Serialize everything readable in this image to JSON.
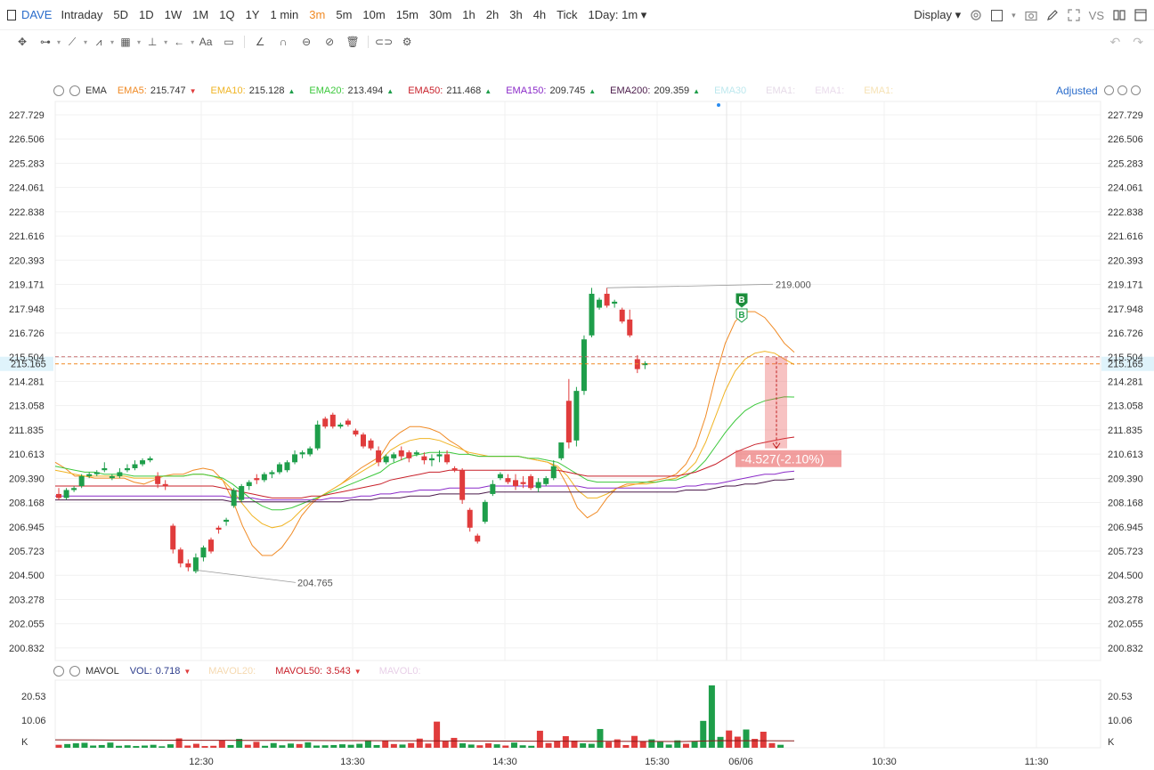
{
  "toolbar": {
    "symbol": "DAVE",
    "timeframes": [
      "Intraday",
      "5D",
      "1D",
      "1W",
      "1M",
      "1Q",
      "1Y",
      "1 min",
      "3m",
      "5m",
      "10m",
      "15m",
      "30m",
      "1h",
      "2h",
      "3h",
      "4h",
      "Tick"
    ],
    "active_timeframe": "3m",
    "range_select": "1Day: 1m",
    "display_label": "Display",
    "vs_label": "VS"
  },
  "ema_legend": {
    "name": "EMA",
    "items": [
      {
        "label": "EMA5:",
        "value": "215.747",
        "dir": "▼",
        "color": "#f08a24"
      },
      {
        "label": "EMA10:",
        "value": "215.128",
        "dir": "▲",
        "color": "#f0b424"
      },
      {
        "label": "EMA20:",
        "value": "213.494",
        "dir": "▲",
        "color": "#3cc83c"
      },
      {
        "label": "EMA50:",
        "value": "211.468",
        "dir": "▲",
        "color": "#c8202a"
      },
      {
        "label": "EMA150:",
        "value": "209.745",
        "dir": "▲",
        "color": "#8a2ac8"
      },
      {
        "label": "EMA200:",
        "value": "209.359",
        "dir": "▲",
        "color": "#4a1a4a"
      }
    ],
    "faded": [
      "EMA30",
      "EMA1:",
      "EMA1:",
      "EMA1:"
    ],
    "adjusted_label": "Adjusted"
  },
  "vol_legend": {
    "name": "MAVOL",
    "vol_label": "VOL:",
    "vol_value": "0.718",
    "mavol20_label": "MAVOL20:",
    "mavol50_label": "MAVOL50:",
    "mavol50_value": "3.543",
    "mavol0_label": "MAVOL0:"
  },
  "price_axis": [
    "227.729",
    "226.506",
    "225.283",
    "224.061",
    "222.838",
    "221.616",
    "220.393",
    "219.171",
    "217.948",
    "216.726",
    "215.504",
    "214.281",
    "213.058",
    "211.835",
    "210.613",
    "209.390",
    "208.168",
    "206.945",
    "205.723",
    "204.500",
    "203.278",
    "202.055",
    "200.832"
  ],
  "current_price": "215.165",
  "volume_axis": [
    "20.53",
    "10.06",
    "K"
  ],
  "time_axis": [
    "12:30",
    "13:30",
    "14:30",
    "15:30",
    "06/06",
    "10:30",
    "11:30"
  ],
  "annotations": {
    "high": "219.000",
    "low": "204.765",
    "measure": "-4.527(-2.10%)",
    "buy_marker": "B"
  },
  "chart_data": {
    "type": "candlestick",
    "ylim": [
      200.2,
      228.4
    ],
    "colors": {
      "up": "#1e9e4a",
      "down": "#e03c3c"
    },
    "candles": [
      [
        208.6,
        208.9,
        208.3,
        208.4
      ],
      [
        208.4,
        208.9,
        208.3,
        208.8
      ],
      [
        208.8,
        209.0,
        208.7,
        208.9
      ],
      [
        209.0,
        209.6,
        208.9,
        209.5
      ],
      [
        209.5,
        209.7,
        209.4,
        209.6
      ],
      [
        209.6,
        209.8,
        209.5,
        209.7
      ],
      [
        209.8,
        210.2,
        209.7,
        209.9
      ],
      [
        209.4,
        209.6,
        209.3,
        209.5
      ],
      [
        209.5,
        209.9,
        209.4,
        209.7
      ],
      [
        209.8,
        210.1,
        209.7,
        209.9
      ],
      [
        209.9,
        210.3,
        209.8,
        210.1
      ],
      [
        210.1,
        210.4,
        210.0,
        210.3
      ],
      [
        210.3,
        210.5,
        210.2,
        210.4
      ],
      [
        209.5,
        209.7,
        208.9,
        209.1
      ],
      [
        209.1,
        209.3,
        208.8,
        209.0
      ],
      [
        207.0,
        207.1,
        205.6,
        205.8
      ],
      [
        205.8,
        205.9,
        204.9,
        205.1
      ],
      [
        205.1,
        205.3,
        204.7,
        204.9
      ],
      [
        204.7,
        205.6,
        204.6,
        205.4
      ],
      [
        205.4,
        206.0,
        205.2,
        205.9
      ],
      [
        206.3,
        206.4,
        205.6,
        205.7
      ],
      [
        206.9,
        207.0,
        206.6,
        206.8
      ],
      [
        207.2,
        207.4,
        207.0,
        207.3
      ],
      [
        208.0,
        208.9,
        207.9,
        208.8
      ],
      [
        208.3,
        209.1,
        208.2,
        209.0
      ],
      [
        209.0,
        209.3,
        208.8,
        209.2
      ],
      [
        209.4,
        209.6,
        209.1,
        209.3
      ],
      [
        209.3,
        209.7,
        209.2,
        209.6
      ],
      [
        209.6,
        209.8,
        209.4,
        209.7
      ],
      [
        209.7,
        210.2,
        209.6,
        210.1
      ],
      [
        209.8,
        210.3,
        209.7,
        210.2
      ],
      [
        210.2,
        210.8,
        210.1,
        210.6
      ],
      [
        210.6,
        210.8,
        210.4,
        210.7
      ],
      [
        210.6,
        211.0,
        210.5,
        210.9
      ],
      [
        210.9,
        212.3,
        210.8,
        212.1
      ],
      [
        212.4,
        212.5,
        211.9,
        212.0
      ],
      [
        212.6,
        212.7,
        211.9,
        212.0
      ],
      [
        212.0,
        212.2,
        211.9,
        212.1
      ],
      [
        212.3,
        212.4,
        212.0,
        212.1
      ],
      [
        211.8,
        211.9,
        211.5,
        211.6
      ],
      [
        211.6,
        211.7,
        210.9,
        211.0
      ],
      [
        211.3,
        211.4,
        210.8,
        210.9
      ],
      [
        210.8,
        211.0,
        210.0,
        210.2
      ],
      [
        210.2,
        210.6,
        210.1,
        210.5
      ],
      [
        210.4,
        210.7,
        210.2,
        210.6
      ],
      [
        210.8,
        211.0,
        210.3,
        210.5
      ],
      [
        210.7,
        210.8,
        210.2,
        210.4
      ],
      [
        210.6,
        210.8,
        210.5,
        210.7
      ],
      [
        210.5,
        210.7,
        210.1,
        210.3
      ],
      [
        210.3,
        210.6,
        210.0,
        210.4
      ],
      [
        210.5,
        210.8,
        210.2,
        210.6
      ],
      [
        210.6,
        210.8,
        210.1,
        210.2
      ],
      [
        209.9,
        210.0,
        209.7,
        209.8
      ],
      [
        209.8,
        209.9,
        208.1,
        208.3
      ],
      [
        207.8,
        207.9,
        206.7,
        206.9
      ],
      [
        206.5,
        206.6,
        206.1,
        206.2
      ],
      [
        207.2,
        208.3,
        207.1,
        208.2
      ],
      [
        208.6,
        209.3,
        208.5,
        209.1
      ],
      [
        209.4,
        209.7,
        209.3,
        209.6
      ],
      [
        209.4,
        209.6,
        209.1,
        209.2
      ],
      [
        209.3,
        209.6,
        208.8,
        209.0
      ],
      [
        209.2,
        209.5,
        208.9,
        209.1
      ],
      [
        209.5,
        209.6,
        208.8,
        208.9
      ],
      [
        208.9,
        209.4,
        208.7,
        209.2
      ],
      [
        209.1,
        209.5,
        209.0,
        209.4
      ],
      [
        209.4,
        210.3,
        209.3,
        210.0
      ],
      [
        210.4,
        211.1,
        210.3,
        211.2
      ],
      [
        213.3,
        214.4,
        210.9,
        211.2
      ],
      [
        211.3,
        214.0,
        211.0,
        213.8
      ],
      [
        213.8,
        216.6,
        213.6,
        216.4
      ],
      [
        216.6,
        219.0,
        216.5,
        218.7
      ],
      [
        218.0,
        218.5,
        217.9,
        218.4
      ],
      [
        218.7,
        219.0,
        218.0,
        218.1
      ],
      [
        218.2,
        218.4,
        218.0,
        218.3
      ],
      [
        217.9,
        218.0,
        217.2,
        217.3
      ],
      [
        217.4,
        217.9,
        216.5,
        216.6
      ],
      [
        215.4,
        215.6,
        214.7,
        214.9
      ],
      [
        215.1,
        215.3,
        214.9,
        215.2
      ]
    ],
    "volume_ylim": [
      0,
      26
    ],
    "volumes": [
      1.2,
      1.5,
      1.8,
      2.0,
      0.9,
      1.1,
      2.1,
      0.8,
      1.0,
      0.7,
      0.9,
      1.2,
      0.6,
      1.4,
      3.8,
      0.9,
      1.6,
      0.7,
      0.8,
      3.0,
      1.1,
      3.6,
      1.2,
      2.4,
      0.8,
      1.9,
      1.0,
      1.7,
      1.5,
      2.2,
      0.9,
      1.0,
      1.1,
      1.4,
      1.2,
      1.6,
      3.0,
      1.1,
      2.8,
      1.5,
      1.3,
      1.9,
      3.7,
      1.7,
      10.6,
      2.6,
      4.0,
      1.8,
      1.3,
      1.0,
      1.8,
      1.4,
      0.9,
      2.1,
      1.0,
      0.8,
      6.9,
      1.9,
      2.6,
      4.7,
      2.9,
      1.8,
      1.6,
      7.6,
      2.4,
      3.4,
      1.1,
      4.8,
      2.6,
      3.4,
      2.4,
      1.3,
      3.0,
      1.6,
      2.5,
      10.9,
      25.3,
      4.4,
      7.0,
      4.5,
      7.4,
      3.6,
      6.5,
      1.9,
      1.2
    ],
    "ema": {
      "EMA5": [
        210.2,
        209.9,
        209.5,
        209.5,
        209.4,
        209.4,
        209.4,
        209.4,
        209.2,
        209.1,
        209.3,
        209.5,
        209.6,
        209.6,
        209.8,
        209.9,
        209.8,
        209.3,
        208.3,
        207.0,
        206.0,
        205.5,
        205.5,
        205.9,
        206.6,
        207.5,
        208.1,
        208.5,
        208.8,
        209.1,
        209.5,
        209.9,
        210.2,
        210.5,
        211.3,
        211.7,
        212.0,
        212.0,
        211.9,
        211.7,
        211.3,
        211.0,
        210.6,
        210.5,
        210.5,
        210.5,
        210.5,
        210.5,
        210.4,
        210.3,
        210.2,
        209.9,
        209.0,
        207.9,
        207.4,
        207.7,
        208.4,
        208.9,
        209.1,
        209.1,
        209.2,
        209.3,
        209.4,
        209.6,
        210.1,
        211.0,
        212.5,
        214.5,
        216.2,
        217.3,
        217.8,
        217.8,
        217.5,
        216.9,
        216.2,
        215.75
      ],
      "EMA10": [
        209.8,
        209.7,
        209.6,
        209.5,
        209.5,
        209.5,
        209.5,
        209.5,
        209.4,
        209.4,
        209.4,
        209.5,
        209.5,
        209.5,
        209.6,
        209.6,
        209.5,
        209.3,
        208.8,
        208.1,
        207.5,
        207.1,
        206.9,
        207.0,
        207.3,
        207.8,
        208.2,
        208.5,
        208.8,
        209.1,
        209.4,
        209.7,
        210.0,
        210.3,
        210.8,
        211.1,
        211.3,
        211.4,
        211.4,
        211.3,
        211.1,
        210.9,
        210.7,
        210.6,
        210.5,
        210.5,
        210.5,
        210.5,
        210.4,
        210.3,
        210.2,
        210.0,
        209.5,
        208.8,
        208.4,
        208.4,
        208.6,
        208.9,
        209.0,
        209.1,
        209.1,
        209.2,
        209.3,
        209.4,
        209.7,
        210.2,
        211.2,
        212.5,
        213.8,
        214.8,
        215.4,
        215.7,
        215.8,
        215.7,
        215.4,
        215.13
      ],
      "EMA20": [
        210.0,
        209.9,
        209.8,
        209.7,
        209.7,
        209.6,
        209.6,
        209.6,
        209.5,
        209.5,
        209.5,
        209.5,
        209.5,
        209.5,
        209.6,
        209.6,
        209.5,
        209.4,
        209.1,
        208.7,
        208.3,
        208.0,
        207.8,
        207.8,
        207.9,
        208.1,
        208.3,
        208.5,
        208.7,
        208.9,
        209.1,
        209.3,
        209.5,
        209.7,
        210.1,
        210.3,
        210.5,
        210.6,
        210.7,
        210.7,
        210.7,
        210.6,
        210.6,
        210.5,
        210.5,
        210.5,
        210.5,
        210.5,
        210.4,
        210.4,
        210.3,
        210.2,
        209.9,
        209.6,
        209.3,
        209.2,
        209.2,
        209.2,
        209.2,
        209.2,
        209.2,
        209.2,
        209.3,
        209.3,
        209.5,
        209.8,
        210.3,
        211.0,
        211.7,
        212.3,
        212.8,
        213.1,
        213.3,
        213.4,
        213.5,
        213.49
      ],
      "EMA50": [
        209.0,
        209.0,
        209.0,
        209.0,
        209.0,
        209.0,
        209.0,
        209.0,
        209.0,
        209.0,
        209.0,
        209.0,
        209.0,
        209.0,
        209.0,
        209.0,
        209.0,
        208.9,
        208.8,
        208.7,
        208.6,
        208.5,
        208.4,
        208.4,
        208.4,
        208.4,
        208.5,
        208.5,
        208.6,
        208.7,
        208.8,
        208.9,
        209.0,
        209.1,
        209.3,
        209.4,
        209.5,
        209.6,
        209.7,
        209.7,
        209.8,
        209.8,
        209.8,
        209.8,
        209.8,
        209.8,
        209.8,
        209.8,
        209.8,
        209.8,
        209.8,
        209.8,
        209.7,
        209.6,
        209.5,
        209.5,
        209.5,
        209.5,
        209.5,
        209.5,
        209.5,
        209.5,
        209.5,
        209.5,
        209.6,
        209.7,
        209.9,
        210.1,
        210.4,
        210.7,
        210.9,
        211.1,
        211.2,
        211.3,
        211.4,
        211.47
      ],
      "EMA150": [
        208.5,
        208.5,
        208.5,
        208.5,
        208.5,
        208.5,
        208.5,
        208.5,
        208.5,
        208.5,
        208.5,
        208.5,
        208.5,
        208.5,
        208.5,
        208.5,
        208.5,
        208.5,
        208.4,
        208.4,
        208.4,
        208.3,
        208.3,
        208.3,
        208.3,
        208.3,
        208.3,
        208.3,
        208.4,
        208.4,
        208.4,
        208.5,
        208.5,
        208.6,
        208.6,
        208.7,
        208.7,
        208.8,
        208.8,
        208.8,
        208.9,
        208.9,
        208.9,
        208.9,
        209.0,
        209.0,
        209.0,
        209.0,
        209.0,
        209.0,
        209.0,
        209.0,
        209.0,
        209.0,
        208.9,
        208.9,
        208.9,
        208.9,
        208.9,
        208.9,
        208.9,
        208.9,
        208.9,
        208.9,
        209.0,
        209.0,
        209.1,
        209.1,
        209.2,
        209.3,
        209.4,
        209.5,
        209.6,
        209.6,
        209.7,
        209.75
      ],
      "EMA200": [
        208.3,
        208.3,
        208.3,
        208.3,
        208.3,
        208.3,
        208.3,
        208.3,
        208.3,
        208.3,
        208.3,
        208.3,
        208.3,
        208.3,
        208.3,
        208.3,
        208.3,
        208.3,
        208.2,
        208.2,
        208.2,
        208.2,
        208.2,
        208.2,
        208.2,
        208.2,
        208.2,
        208.2,
        208.2,
        208.2,
        208.3,
        208.3,
        208.3,
        208.4,
        208.4,
        208.4,
        208.5,
        208.5,
        208.5,
        208.6,
        208.6,
        208.6,
        208.6,
        208.6,
        208.7,
        208.7,
        208.7,
        208.7,
        208.7,
        208.7,
        208.7,
        208.7,
        208.7,
        208.7,
        208.7,
        208.7,
        208.7,
        208.7,
        208.7,
        208.7,
        208.7,
        208.7,
        208.7,
        208.7,
        208.8,
        208.8,
        208.8,
        208.9,
        209.0,
        209.0,
        209.1,
        209.1,
        209.2,
        209.3,
        209.3,
        209.36
      ]
    }
  }
}
